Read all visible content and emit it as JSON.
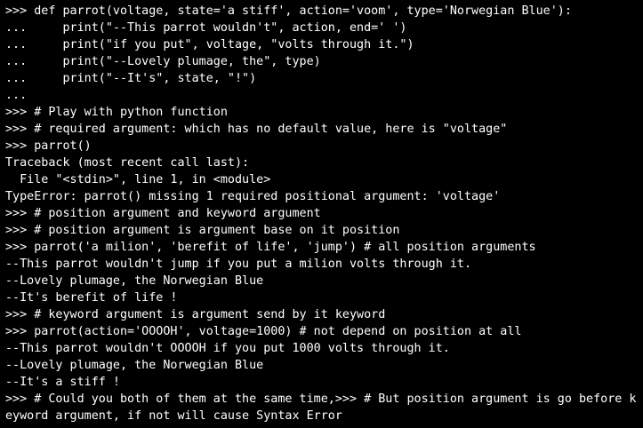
{
  "colors": {
    "background": "#000000",
    "foreground": "#ffffff"
  },
  "terminal": {
    "lines": [
      ">>> def parrot(voltage, state='a stiff', action='voom', type='Norwegian Blue'):",
      "...     print(\"--This parrot wouldn't\", action, end=' ')",
      "...     print(\"if you put\", voltage, \"volts through it.\")",
      "...     print(\"--Lovely plumage, the\", type)",
      "...     print(\"--It's\", state, \"!\")",
      "...",
      ">>> # Play with python function",
      ">>> # required argument: which has no default value, here is \"voltage\"",
      ">>> parrot()",
      "Traceback (most recent call last):",
      "  File \"<stdin>\", line 1, in <module>",
      "TypeError: parrot() missing 1 required positional argument: 'voltage'",
      ">>> # position argument and keyword argument",
      ">>> # position argument is argument base on it position",
      ">>> parrot('a milion', 'berefit of life', 'jump') # all position arguments",
      "--This parrot wouldn't jump if you put a milion volts through it.",
      "--Lovely plumage, the Norwegian Blue",
      "--It's berefit of life !",
      ">>> # keyword argument is argument send by it keyword",
      ">>> parrot(action='OOOOH', voltage=1000) # not depend on position at all",
      "--This parrot wouldn't OOOOH if you put 1000 volts through it.",
      "--Lovely plumage, the Norwegian Blue",
      "--It's a stiff !",
      ">>> # Could you both of them at the same time,>>> # But position argument is go before k",
      "eyword argument, if not will cause Syntax Error"
    ]
  }
}
